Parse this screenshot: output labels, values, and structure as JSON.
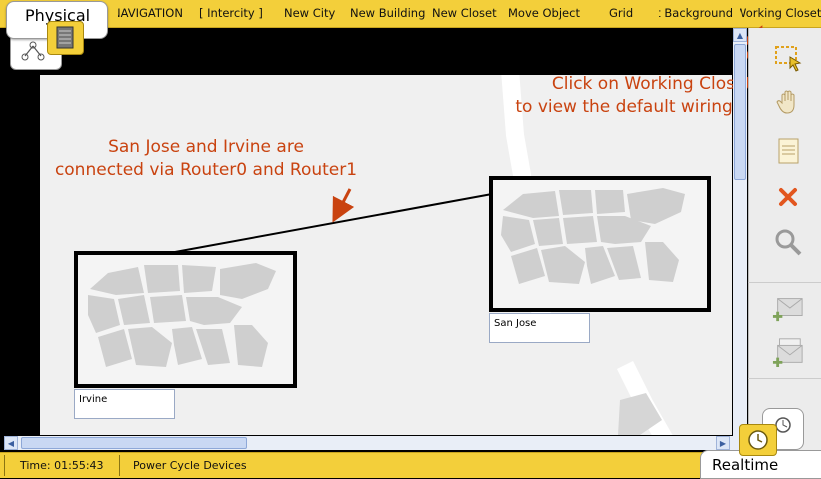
{
  "topbar": {
    "mode": "Physical",
    "menu": [
      "NAVIGATION",
      "[ Intercity ]",
      "New City",
      "New Building",
      "New Closet",
      "Move Object",
      "Grid",
      "Set Background",
      "Working Closet"
    ]
  },
  "cities": {
    "san_jose": "San Jose",
    "irvine": "Irvine"
  },
  "annotations": {
    "connect_line1": "San Jose and Irvine are",
    "connect_line2": "connected via Router0 and Router1",
    "closet_line1": "Click on Working Closet",
    "closet_line2": "to view the default wiring closet"
  },
  "right_panel_icons": [
    "select-icon",
    "move-hand-icon",
    "note-icon",
    "delete-icon",
    "inspect-icon",
    "add-simple-pdu-icon",
    "add-complex-pdu-icon"
  ],
  "bottombar": {
    "time": "Time: 01:55:43",
    "power_cycle": "Power Cycle Devices",
    "realtime": "Realtime"
  },
  "colors": {
    "toolbar": "#f3cf3a",
    "annotation": "#c94310",
    "canvas": "#f0f0f0"
  }
}
